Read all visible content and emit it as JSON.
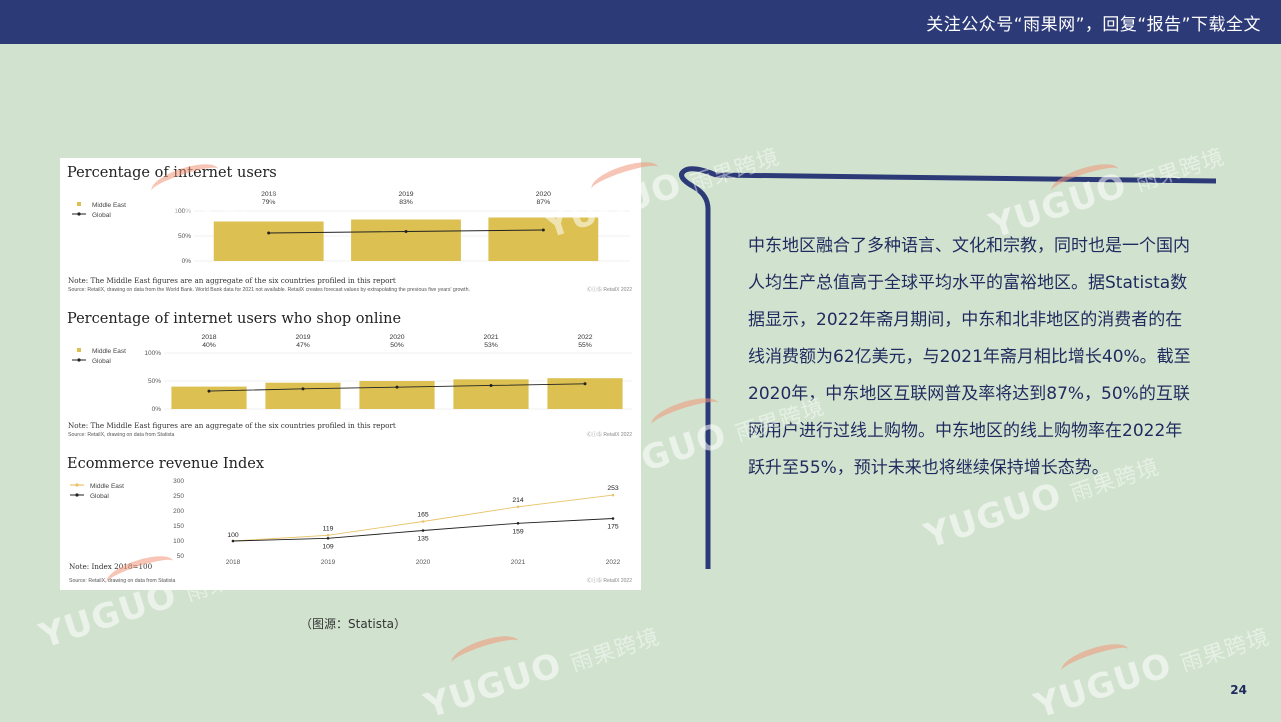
{
  "header": {
    "text": "关注公众号“雨果网”，回复“报告”下载全文"
  },
  "caption": "（图源：Statista）",
  "body_text": "中东地区融合了多种语言、文化和宗教，同时也是一个国内人均生产总值高于全球平均水平的富裕地区。据Statista数据显示，2022年斋月期间，中东和北非地区的消费者的在线消费额为62亿美元，与2021年斋月相比增长40%。截至2020年，中东地区互联网普及率将达到87%，50%的互联网用户进行过线上购物。中东地区的线上购物率在2022年跃升至55%，预计未来也将继续保持增长态势。",
  "page_number": "24",
  "watermark": {
    "latin": "YUGUO",
    "cn": "雨果跨境"
  },
  "colors": {
    "bar": "#dcc152",
    "line_global": "#222222",
    "line_me": "#e8c36a",
    "header_bg": "#2d3a78",
    "page_bg": "#d1e3cf"
  },
  "chart_data": [
    {
      "type": "bar",
      "title": "Percentage of internet users",
      "categories": [
        "2018",
        "2019",
        "2020"
      ],
      "value_labels": [
        "79%",
        "83%",
        "87%"
      ],
      "series": [
        {
          "name": "Middle East",
          "values": [
            79,
            83,
            87
          ]
        },
        {
          "name": "Global",
          "values": [
            56,
            59,
            62
          ]
        }
      ],
      "yticks": [
        "100%",
        "50%",
        "0%"
      ],
      "ylim": [
        0,
        100
      ],
      "note": "Note: The Middle East figures are an aggregate of the six countries profiled in this report",
      "source": "Source: RetailX, drawing on data from the World Bank. World Bank data for 2021 not available. RetailX creates forecast values by extrapolating the previous five years' growth.",
      "credit": "RetailX 2022"
    },
    {
      "type": "bar",
      "title": "Percentage of internet users who shop online",
      "categories": [
        "2018",
        "2019",
        "2020",
        "2021",
        "2022"
      ],
      "value_labels": [
        "40%",
        "47%",
        "50%",
        "53%",
        "55%"
      ],
      "series": [
        {
          "name": "Middle East",
          "values": [
            40,
            47,
            50,
            53,
            55
          ]
        },
        {
          "name": "Global",
          "values": [
            32,
            36,
            39,
            42,
            45
          ]
        }
      ],
      "yticks": [
        "100%",
        "50%",
        "0%"
      ],
      "ylim": [
        0,
        100
      ],
      "note": "Note: The Middle East figures are an aggregate of the six countries profiled in this report",
      "source": "Source: RetailX, drawing on data from Statista",
      "credit": "RetailX 2022"
    },
    {
      "type": "line",
      "title": "Ecommerce revenue Index",
      "x": [
        "2018",
        "2019",
        "2020",
        "2021",
        "2022"
      ],
      "series": [
        {
          "name": "Middle East",
          "values": [
            100,
            119,
            165,
            214,
            253
          ]
        },
        {
          "name": "Global",
          "values": [
            100,
            109,
            135,
            159,
            175
          ]
        }
      ],
      "yticks": [
        "300",
        "250",
        "200",
        "150",
        "100",
        "50"
      ],
      "ylim": [
        50,
        300
      ],
      "note": "Note: Index 2018=100",
      "source": "Source: RetailX, drawing on data from Statista",
      "credit": "RetailX 2022"
    }
  ]
}
